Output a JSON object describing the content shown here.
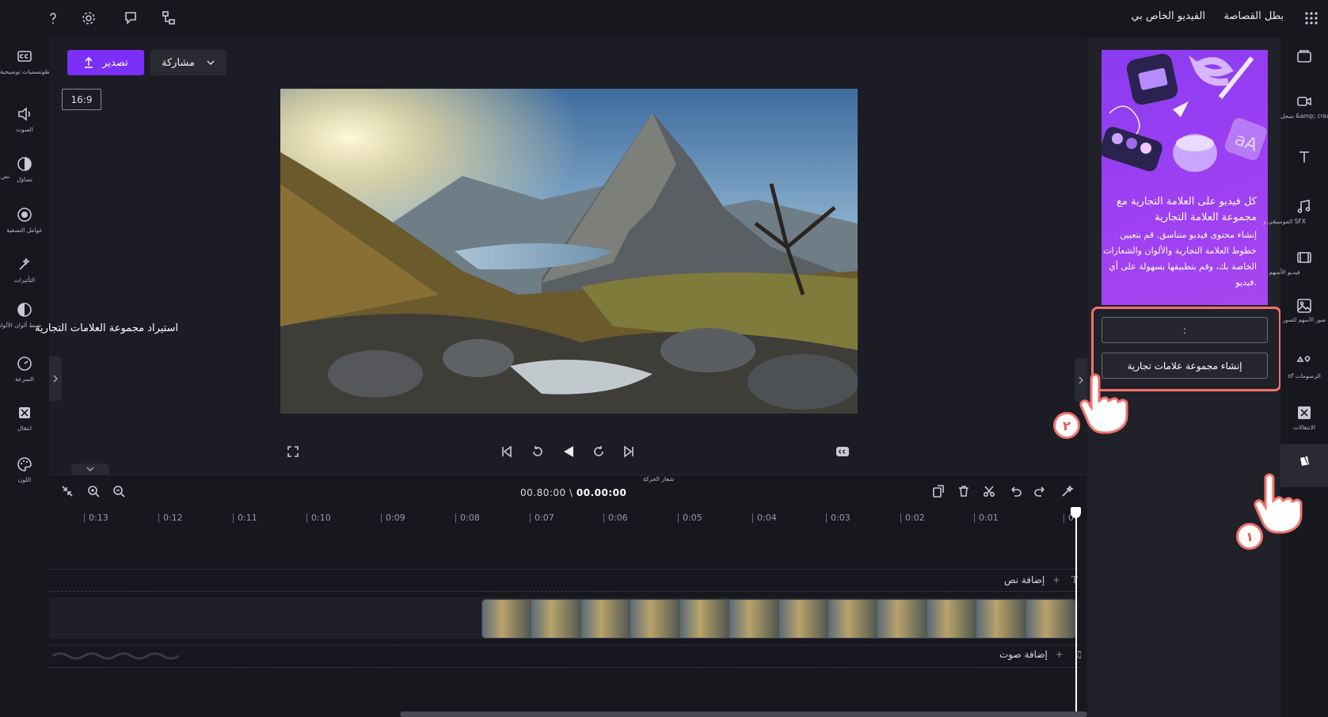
{
  "topbar": {
    "brand": "بطل القصاصة",
    "project_title": "الفيديو الخاص بي",
    "icons": [
      "help-icon",
      "gear-icon",
      "feedback-icon",
      "network-icon",
      "apps-grid-icon"
    ]
  },
  "left_rail": [
    {
      "label": "وسائطوتسميات توضيحية",
      "icon": "captions-icon"
    },
    {
      "label": "الصوت",
      "icon": "audio-icon"
    },
    {
      "label": "تضاؤل",
      "icon": "fade-icon"
    },
    {
      "label": "عوامل التصفية",
      "icon": "filters-icon"
    },
    {
      "label": "التأثيرات",
      "icon": "effects-icon"
    },
    {
      "label": "ضبط ألوان الألوان",
      "icon": "color-adjust-icon"
    },
    {
      "label": "السرعة",
      "icon": "speed-icon"
    },
    {
      "label": "انتقال",
      "icon": "transition-icon"
    },
    {
      "label": "اللون",
      "icon": "palette-icon"
    }
  ],
  "left_rail_side_label": "نص",
  "toolbar": {
    "export_label": "تصدير",
    "share_label": "مشاركة",
    "aspect_ratio": "16:9"
  },
  "tooltip": {
    "text": "استيراد مجموعة العلامات التجارية"
  },
  "timeline": {
    "current_time": "00.00:00",
    "separator": "\\",
    "total_time": "00.80:00",
    "playhead_label": "شعار الحركة",
    "ticks": [
      "0",
      "0:01",
      "0:02",
      "0:03",
      "0:04",
      "0:05",
      "0:06",
      "0:07",
      "0:08",
      "0:09",
      "0:10",
      "0:11",
      "0:12",
      "0:13"
    ],
    "add_text_label": "إضافة نص",
    "add_audio_label": "إضافة صوت"
  },
  "panel": {
    "promo_title": "كل فيديو على العلامة التجارية مع مجموعة العلامة التجارية",
    "promo_body": "إنشاء محتوى فيديو متناسق. قم بتعيين خطوط العلامة التجارية والألوان والشعارات الخاصة بك، وقم بتطبيقها بسهولة على أي فيديو.",
    "import_label": ":",
    "create_label": "إنشاء مجموعة علامات تجارية"
  },
  "right_rail": [
    {
      "label": "",
      "icon": "media-icon"
    },
    {
      "label": "سجل &amp; create",
      "icon": "record-icon"
    },
    {
      "label": "",
      "icon": "text-icon"
    },
    {
      "label": "الموسيقى و SFX",
      "icon": "music-icon"
    },
    {
      "label": "فيديو الأسهم",
      "icon": "stock-video-icon"
    },
    {
      "label": "صور الأسهم للصور",
      "icon": "stock-image-icon"
    },
    {
      "label": "of الرسومات",
      "icon": "graphics-icon"
    },
    {
      "label": "الانتقالات",
      "icon": "transitions-icon"
    },
    {
      "label": "",
      "icon": "brand-kit-icon"
    }
  ],
  "steps": [
    "١",
    "٢"
  ],
  "colors": {
    "accent": "#7b2ff7",
    "highlight": "#f0736b",
    "background": "#17171e",
    "panel": "#21212a"
  }
}
